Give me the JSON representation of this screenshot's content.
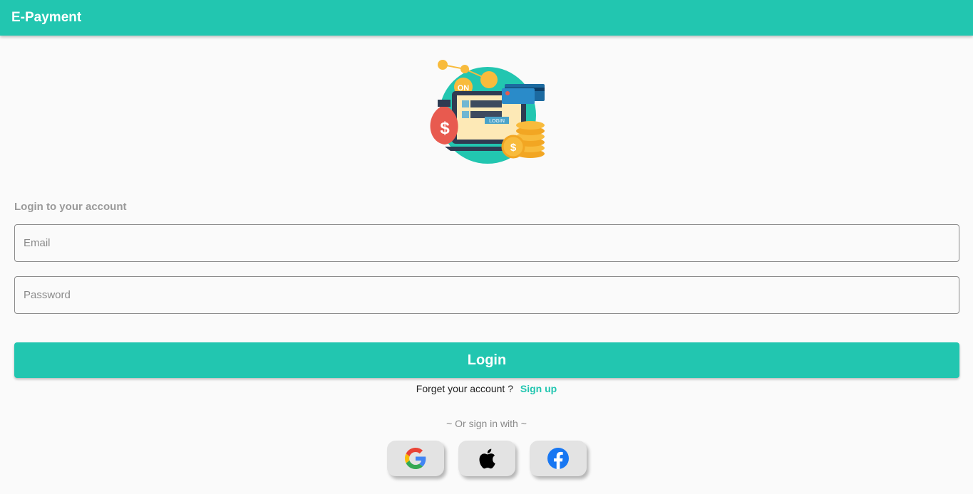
{
  "appbar": {
    "title": "E-Payment"
  },
  "hero": {
    "illustration": "laptop-login-payment-illustration",
    "badge_text": "ON",
    "login_label": "LOGIN",
    "currency_symbol": "$"
  },
  "form": {
    "heading": "Login to your account",
    "email_placeholder": "Email",
    "password_placeholder": "Password",
    "login_label": "Login"
  },
  "account": {
    "forget_text": "Forget your account ?",
    "signup_label": "Sign up"
  },
  "social": {
    "divider_text": "~ Or sign in with ~",
    "providers": [
      "google-icon",
      "apple-icon",
      "facebook-icon"
    ]
  },
  "colors": {
    "primary": "#22c6b0",
    "background": "#fafafa",
    "muted": "#9a9a9a"
  }
}
